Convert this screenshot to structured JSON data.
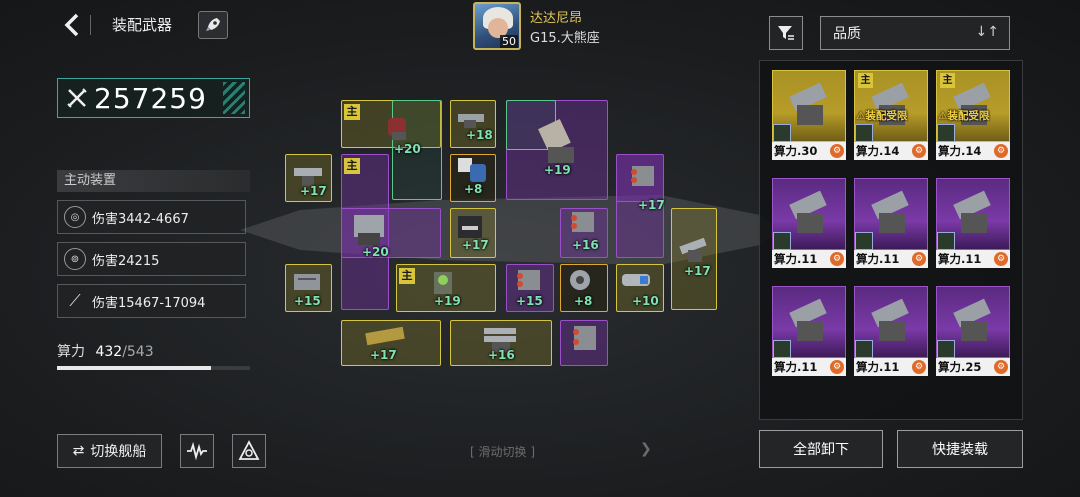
{
  "header": {
    "title": "装配武器"
  },
  "commander": {
    "name": "达达尼昂",
    "level": "50",
    "ship": "G15.大熊座"
  },
  "power": {
    "value": "257259"
  },
  "active_devices": {
    "header": "主动装置",
    "rows": [
      {
        "icon": "target-icon",
        "text": "伤害3442-4667"
      },
      {
        "icon": "shield-ring-icon",
        "text": "伤害24215"
      },
      {
        "icon": "missile-icon",
        "text": "伤害15467-17094"
      }
    ]
  },
  "compute": {
    "label": "算力",
    "used": "432",
    "total": "/543",
    "fraction": 0.7956
  },
  "buttons": {
    "switch_ship": "切换舰船",
    "unload_all": "全部卸下",
    "quick_equip": "快捷装载"
  },
  "swipe_hint": "滑动切换",
  "filter": {
    "quality": "品质"
  },
  "slot_bonuses": [
    "+20",
    "+18",
    "+19",
    "+17",
    "+8",
    "+17",
    "+20",
    "+17",
    "+16",
    "+17",
    "+15",
    "+19",
    "+15",
    "+8",
    "+10",
    "+17",
    "+16"
  ],
  "main_label": "主",
  "inventory": {
    "cards": [
      {
        "rarity": "gold",
        "power": "算力.30",
        "main": "",
        "limit": ""
      },
      {
        "rarity": "gold",
        "power": "算力.14",
        "main": "主",
        "limit": "装配受限"
      },
      {
        "rarity": "gold",
        "power": "算力.14",
        "main": "主",
        "limit": "装配受限"
      },
      {
        "rarity": "purple",
        "power": "算力.11",
        "main": "",
        "limit": ""
      },
      {
        "rarity": "purple",
        "power": "算力.11",
        "main": "",
        "limit": ""
      },
      {
        "rarity": "purple",
        "power": "算力.11",
        "main": "",
        "limit": ""
      },
      {
        "rarity": "purple",
        "power": "算力.11",
        "main": "",
        "limit": ""
      },
      {
        "rarity": "purple",
        "power": "算力.11",
        "main": "",
        "limit": ""
      },
      {
        "rarity": "purple",
        "power": "算力.25",
        "main": "",
        "limit": ""
      }
    ]
  }
}
